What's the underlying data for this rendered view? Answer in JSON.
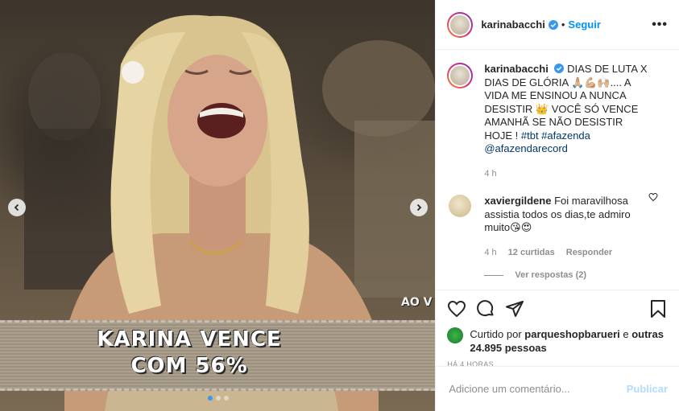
{
  "post": {
    "author": "karinabacchi",
    "follow_label": "Seguir",
    "more_label": "•••"
  },
  "media": {
    "caption_line1": "KARINA VENCE",
    "caption_line2": "COM 56%",
    "overlay_text": "AO V",
    "slide_count": 3,
    "active_slide": 1
  },
  "caption": {
    "author": "karinabacchi",
    "text": "DIAS DE LUTA X DIAS DE GLÓRIA 🙏🏼💪🏼🙌🏼.... A VIDA ME ENSINOU A NUNCA DESISTIR 👑 VOCÊ SÓ VENCE AMANHÃ SE NÃO DESISTIR HOJE ! ",
    "hashtags": "#tbt #afazenda @afazendarecord",
    "time": "4 h"
  },
  "comment": {
    "author": "xaviergildene",
    "text": "Foi maravilhosa assistia todos os dias,te admiro muito😘😍",
    "time": "4 h",
    "likes": "12 curtidas",
    "reply_label": "Responder",
    "view_replies": "Ver respostas (2)"
  },
  "partial_comment": {
    "hearts": "❤️❤️❤️❤️❤️❤️"
  },
  "likes": {
    "prefix": "Curtido por ",
    "user": "parqueshopbarueri",
    "middle": " e ",
    "others": "outras 24.895 pessoas"
  },
  "timestamp": "HÁ 4 HORAS",
  "comment_box": {
    "placeholder": "Adicione um comentário...",
    "publish_label": "Publicar"
  },
  "colors": {
    "link_blue": "#0095f6",
    "hashtag": "#00376b",
    "publish_disabled": "#b3dbff",
    "muted": "#8e8e8e"
  }
}
